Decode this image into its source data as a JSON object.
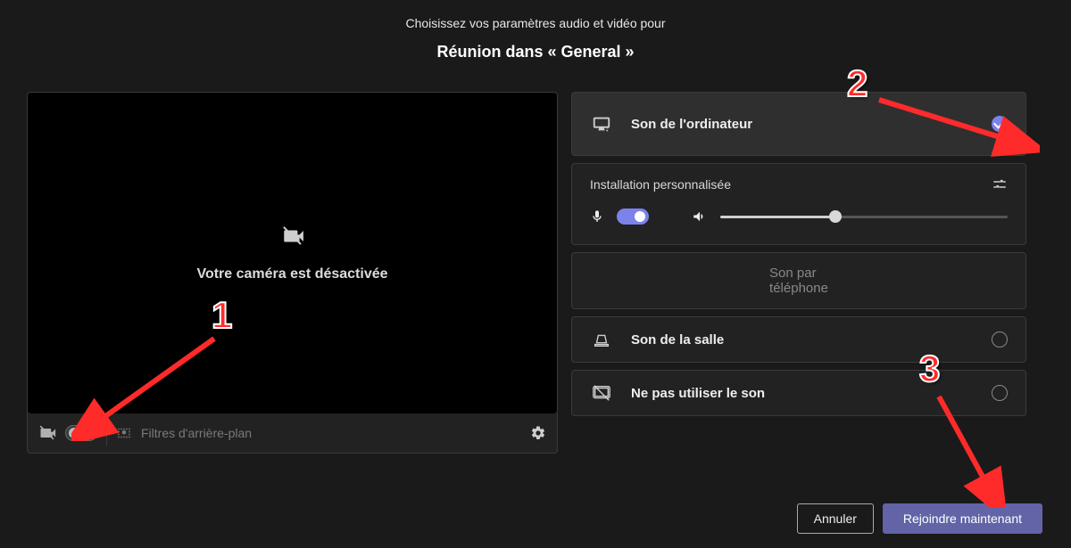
{
  "header": {
    "subtitle": "Choisissez vos paramètres audio et vidéo pour",
    "title": "Réunion dans « General »"
  },
  "video": {
    "camera_off_text": "Votre caméra est désactivée",
    "filters_label": "Filtres d'arrière-plan",
    "camera_toggle_on": false
  },
  "audio": {
    "computer_label": "Son de l'ordinateur",
    "custom_label": "Installation personnalisée",
    "phone_label": "Son par téléphone",
    "room_label": "Son de la salle",
    "none_label": "Ne pas utiliser le son",
    "mic_toggle_on": true,
    "volume_percent": 40,
    "selected": "computer"
  },
  "buttons": {
    "cancel": "Annuler",
    "join": "Rejoindre maintenant"
  },
  "annotations": {
    "n1": "1",
    "n2": "2",
    "n3": "3"
  },
  "colors": {
    "accent": "#6264a7",
    "accent_light": "#7b83eb",
    "annotation": "#ff2a2a"
  }
}
